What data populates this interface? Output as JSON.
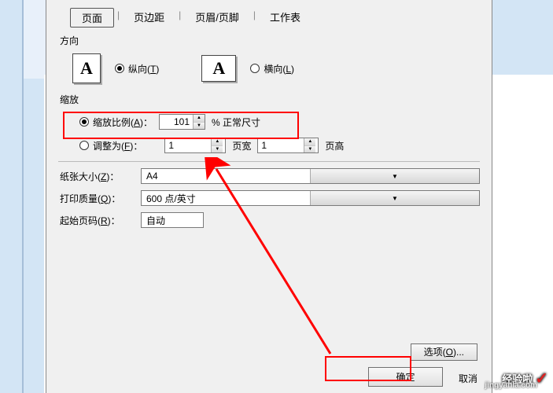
{
  "tabs": {
    "page": "页面",
    "margins": "页边距",
    "header_footer": "页眉/页脚",
    "sheet": "工作表"
  },
  "orientation": {
    "group_label": "方向",
    "portrait": "纵向(T)",
    "landscape": "横向(L)"
  },
  "scale": {
    "group_label": "缩放",
    "adjust_to": "缩放比例(A)：",
    "adjust_value": "101",
    "normal_size": "% 正常尺寸",
    "fit_to": "调整为(F)：",
    "pages_wide_value": "1",
    "pages_wide_label": "页宽",
    "pages_tall_value": "1",
    "pages_tall_label": "页高"
  },
  "paper": {
    "size_label": "纸张大小(Z)：",
    "size_value": "A4",
    "quality_label": "打印质量(Q)：",
    "quality_value": "600 点/英寸",
    "first_page_label": "起始页码(R)：",
    "first_page_value": "自动"
  },
  "buttons": {
    "options": "选项(O)...",
    "ok": "确定",
    "cancel": "取消"
  },
  "watermark": {
    "brand": "经验啦",
    "domain": "jingyanla.com"
  }
}
